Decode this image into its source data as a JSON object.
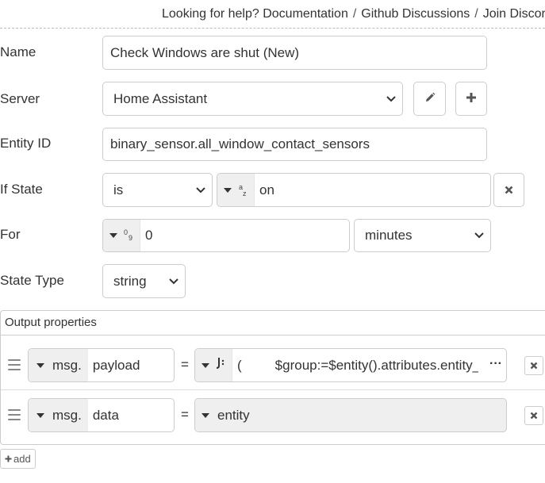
{
  "help": {
    "prefix": "Looking for help?",
    "links": [
      "Documentation",
      "Github Discussions",
      "Join Discord"
    ],
    "separator": "/"
  },
  "form": {
    "name": {
      "label": "Name",
      "value": "Check Windows are shut (New)"
    },
    "server": {
      "label": "Server",
      "value": "Home Assistant"
    },
    "entity_id": {
      "label": "Entity ID",
      "value": "binary_sensor.all_window_contact_sensors"
    },
    "if_state": {
      "label": "If State",
      "operator": "is",
      "value_type_icon": "string-type-icon",
      "value": "on"
    },
    "for": {
      "label": "For",
      "value_type_icon": "number-type-icon",
      "value": "0",
      "unit": "minutes"
    },
    "state_type": {
      "label": "State Type",
      "value": "string"
    }
  },
  "output": {
    "title": "Output properties",
    "rows": [
      {
        "prefix": "msg.",
        "property": "payload",
        "eq": "=",
        "type_icon": "jsonata-icon",
        "paren": "(",
        "expr": "$group:=$entity().attributes.entity_"
      },
      {
        "prefix": "msg.",
        "property": "data",
        "eq": "=",
        "type_icon": "none",
        "expr": "entity"
      }
    ],
    "add_label": "add"
  },
  "icons": {
    "edit": "pencil-icon",
    "add_server": "plus-icon",
    "clear_state": "close-icon",
    "delete_row": "close-icon",
    "drag": "drag-handle-icon",
    "more": "ellipsis-icon"
  },
  "colors": {
    "text": "#333333",
    "border": "#cccccc",
    "type_bg": "#efefef"
  }
}
